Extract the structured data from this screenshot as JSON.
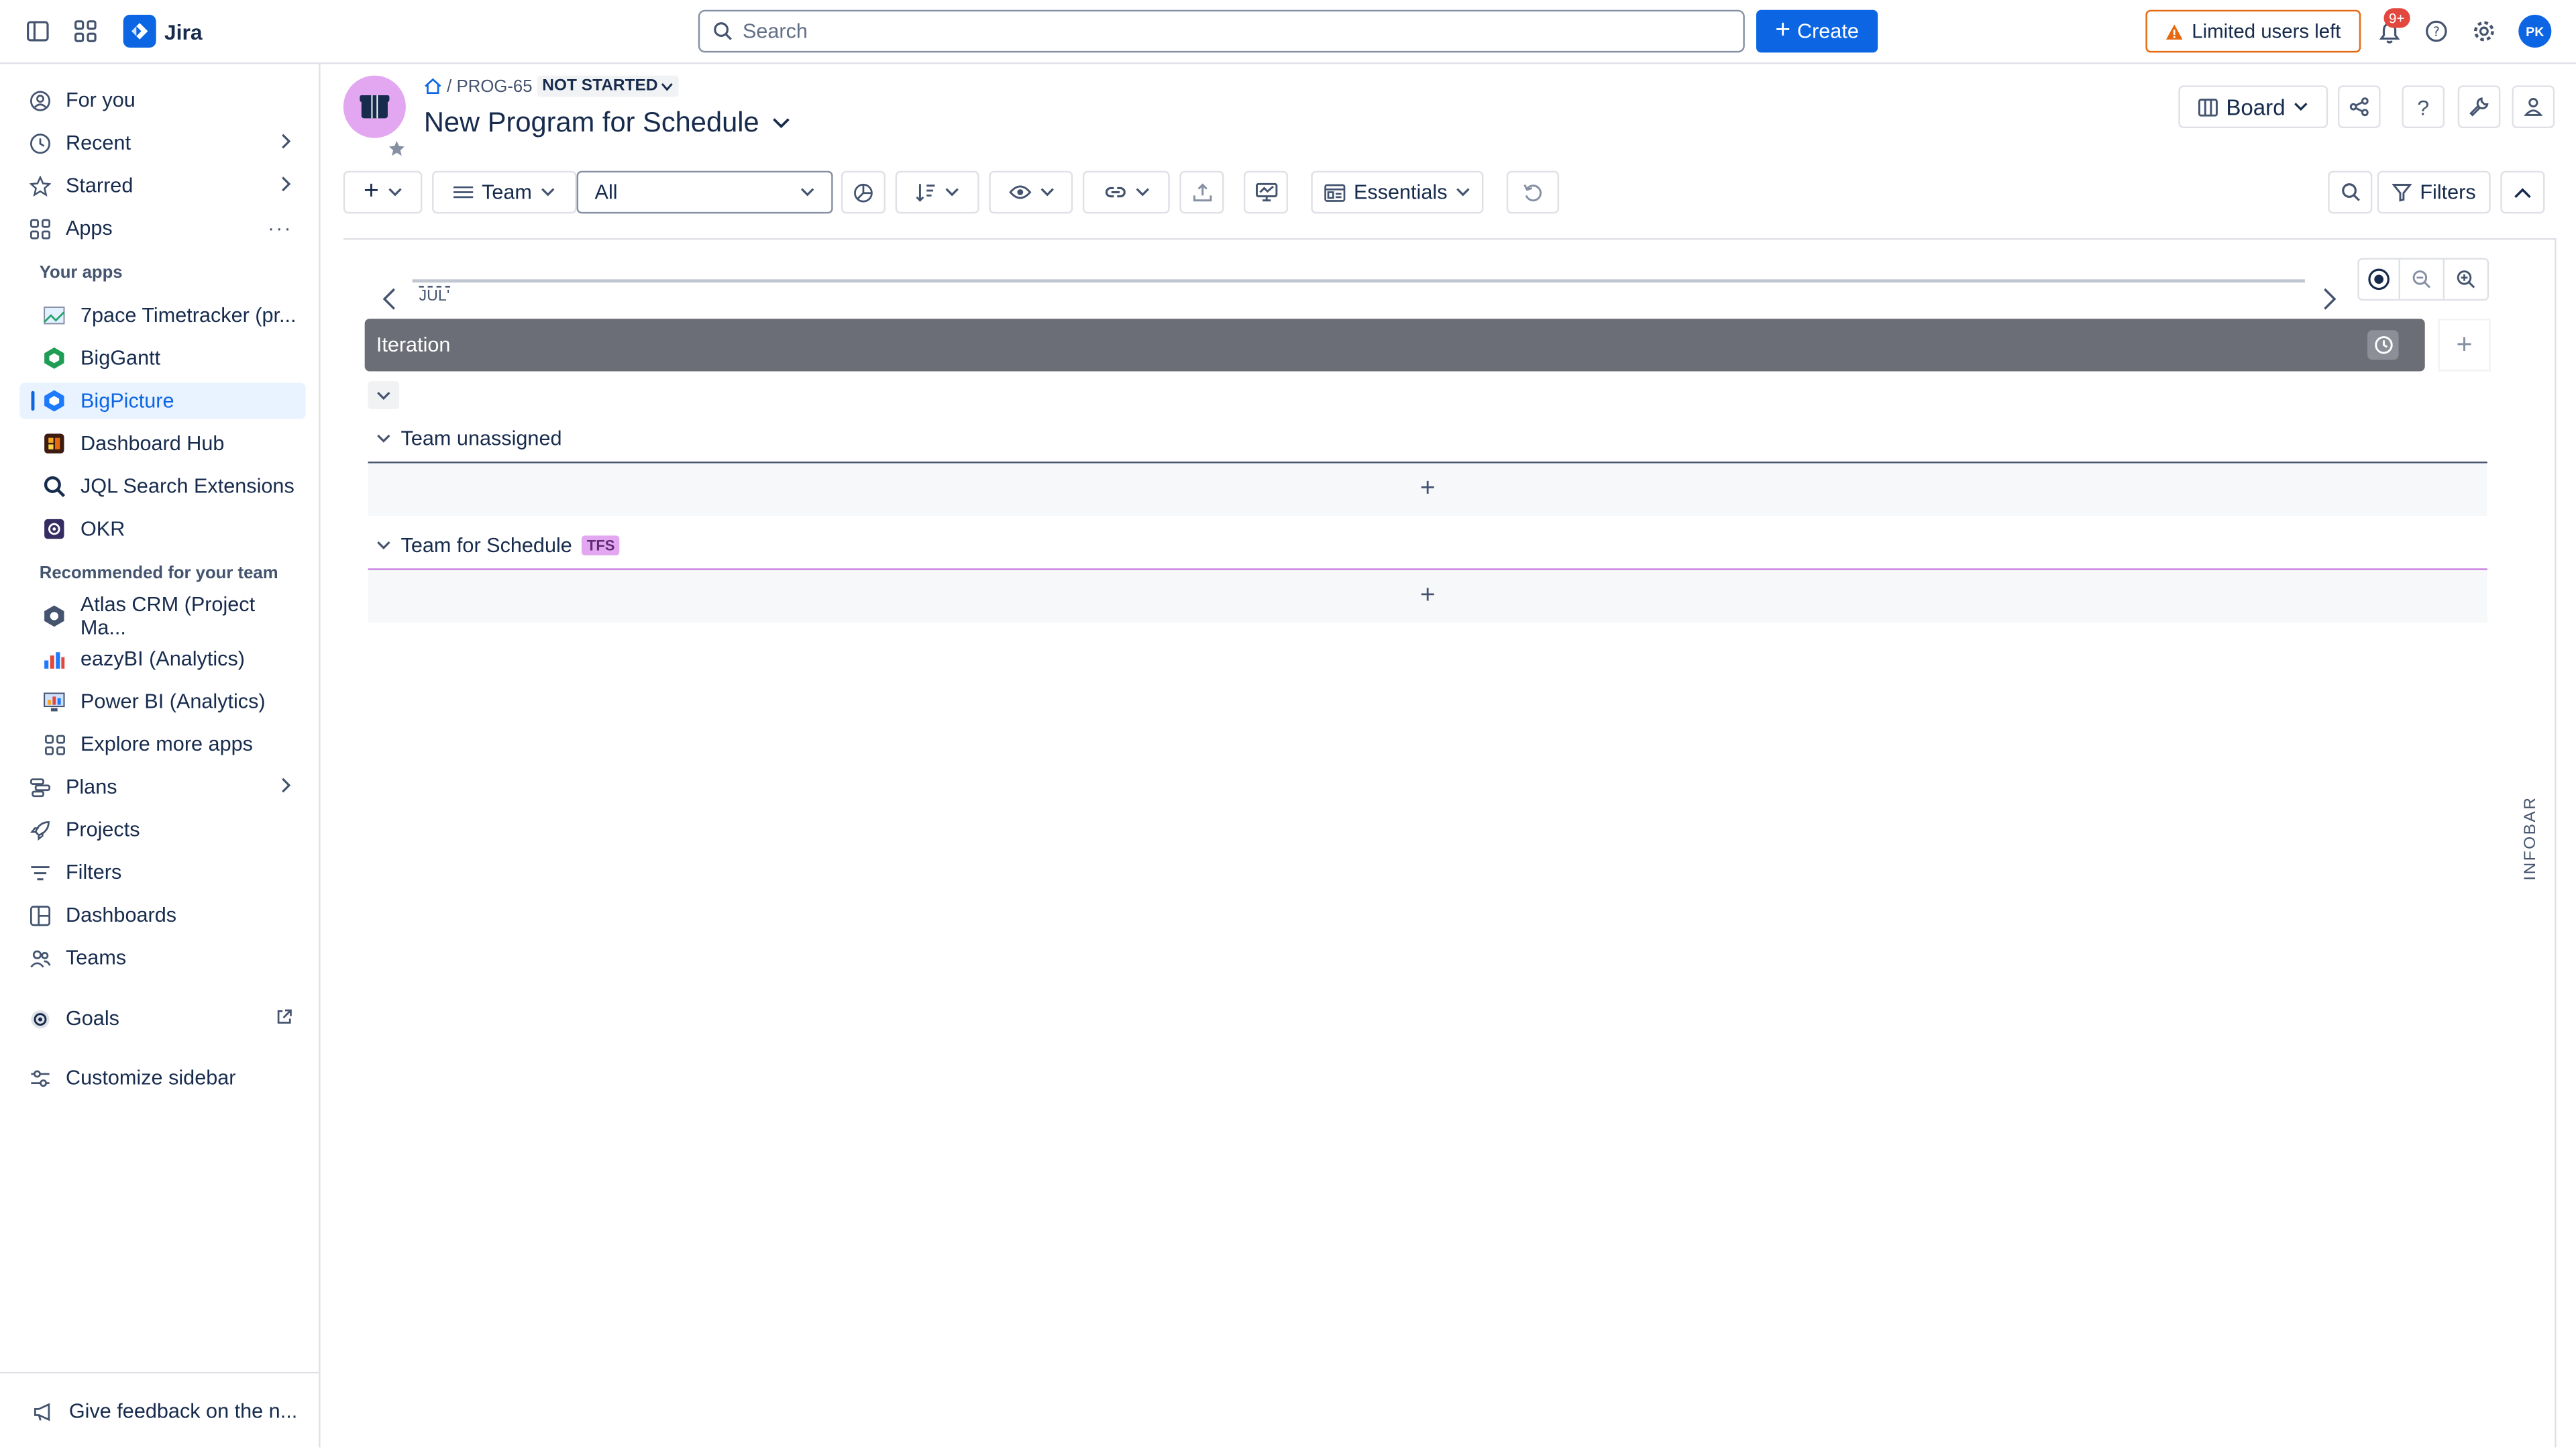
{
  "topbar": {
    "app_name": "Jira",
    "search_placeholder": "Search",
    "create_label": "Create",
    "limited_label": "Limited users left",
    "notif_badge": "9+",
    "avatar_initials": "PK"
  },
  "sidebar": {
    "items": {
      "for_you": "For you",
      "recent": "Recent",
      "starred": "Starred",
      "apps": "Apps",
      "plans": "Plans",
      "projects": "Projects",
      "filters": "Filters",
      "dashboards": "Dashboards",
      "teams": "Teams",
      "goals": "Goals",
      "customize": "Customize sidebar",
      "feedback": "Give feedback on the n..."
    },
    "your_apps_heading": "Your apps",
    "your_apps": [
      "7pace Timetracker (pr...",
      "BigGantt",
      "BigPicture",
      "Dashboard Hub",
      "JQL Search Extensions",
      "OKR"
    ],
    "recommended_heading": "Recommended for your team",
    "recommended": [
      "Atlas CRM (Project Ma...",
      "eazyBI (Analytics)",
      "Power BI (Analytics)",
      "Explore more apps"
    ]
  },
  "header": {
    "issue_key": "PROG-65",
    "status": "NOT STARTED",
    "title": "New Program for Schedule",
    "board_label": "Board"
  },
  "toolbar": {
    "group_label": "Team",
    "filter_value": "All",
    "view_label": "Essentials",
    "filters_label": "Filters"
  },
  "timeline": {
    "month_label": "JUL'",
    "iteration_label": "Iteration"
  },
  "groups": [
    {
      "name": "Team unassigned",
      "badge": ""
    },
    {
      "name": "Team for Schedule",
      "badge": "TFS"
    }
  ],
  "infobar_label": "INFOBAR",
  "colors": {
    "accent": "#0c66e4",
    "warning": "#e56910",
    "iteration_bar": "#6b6e76",
    "team_badge": "#e2a7f0"
  }
}
